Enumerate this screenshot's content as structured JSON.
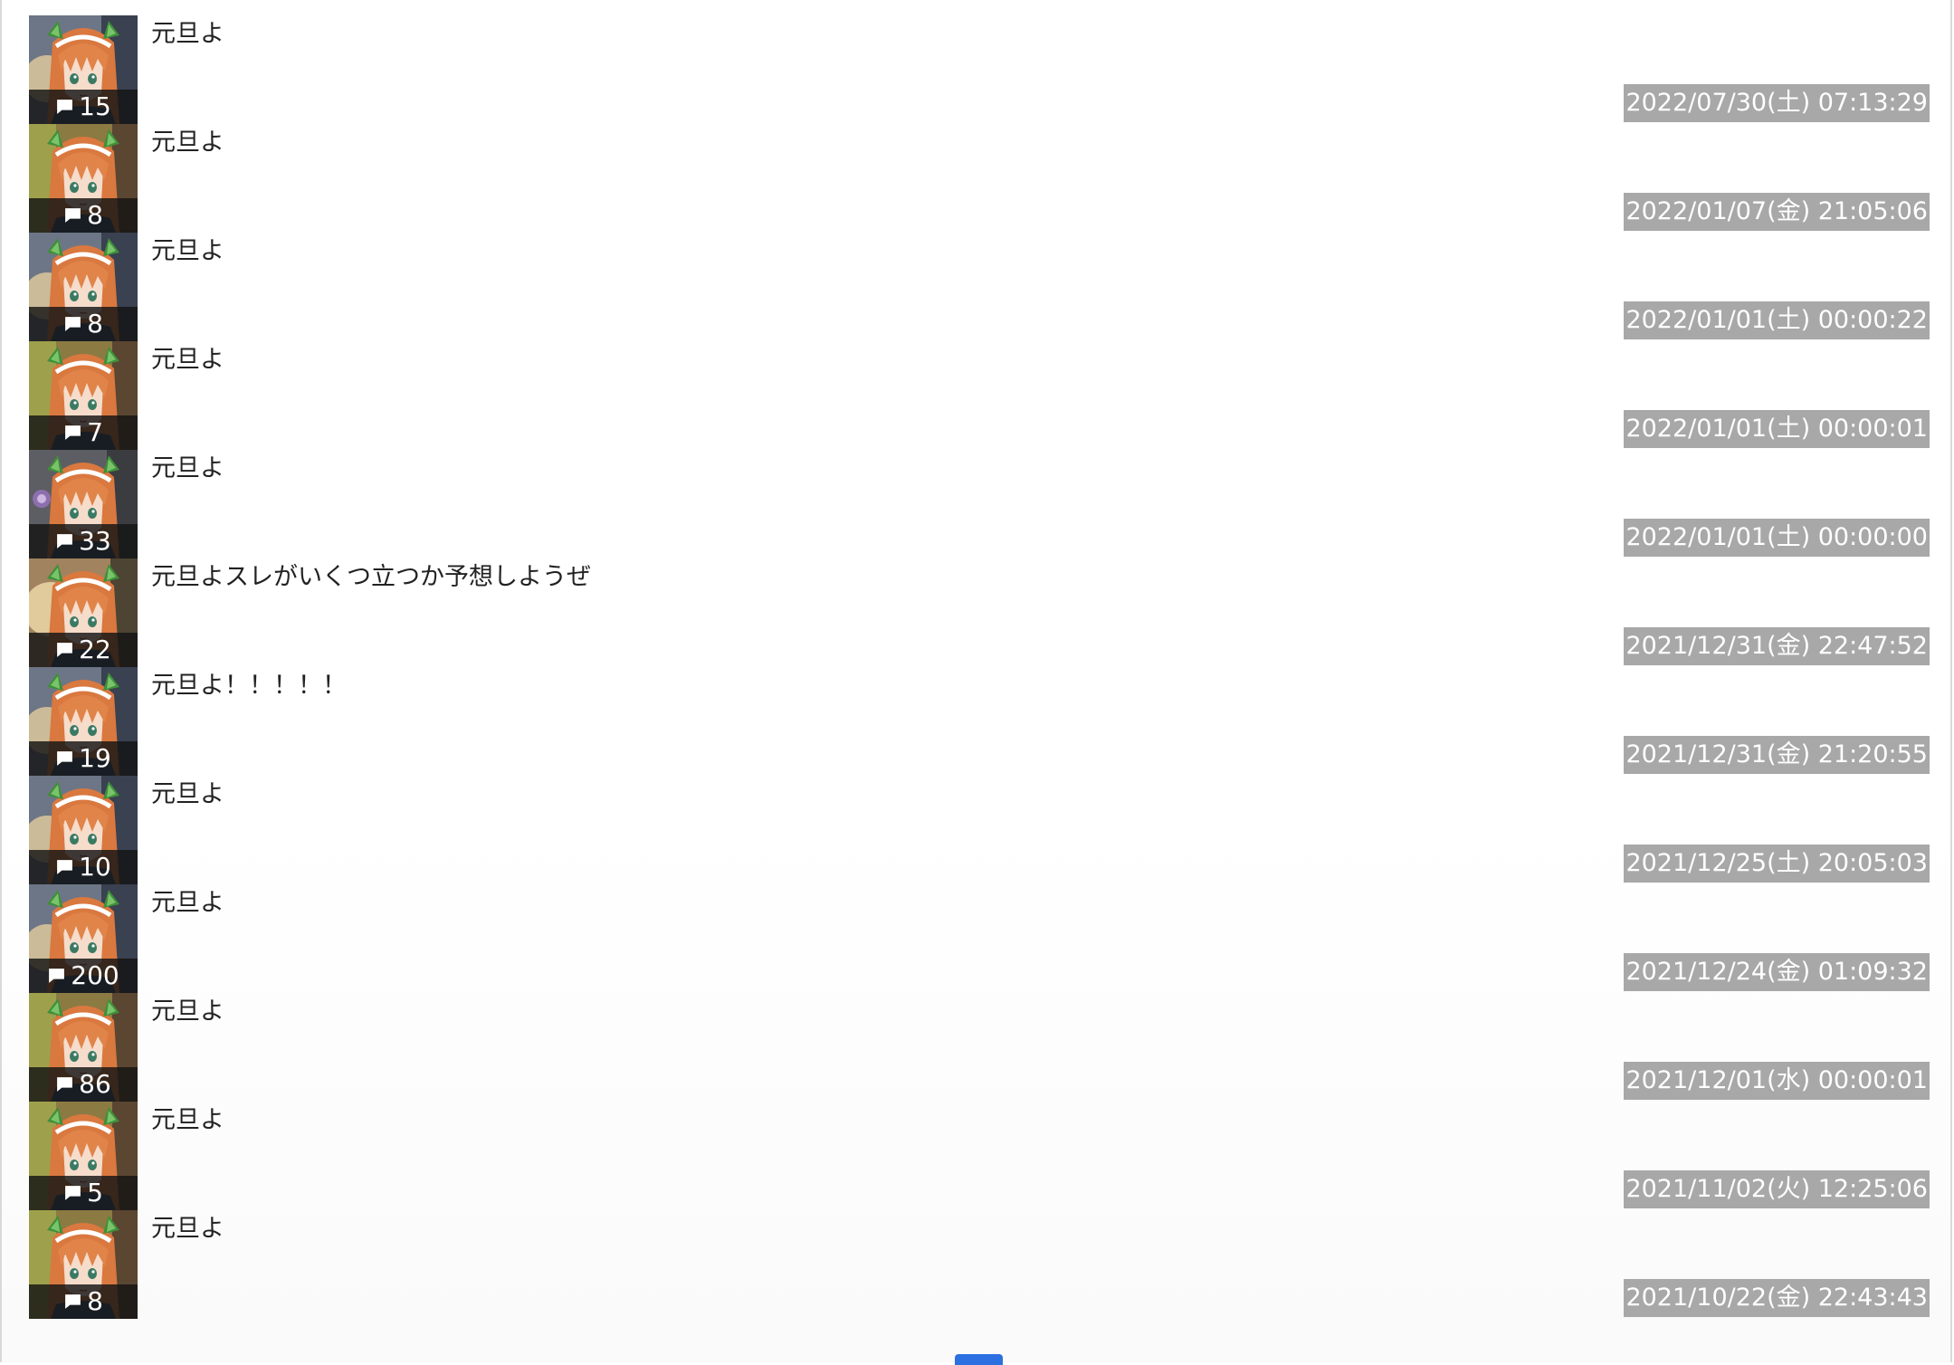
{
  "colors": {
    "date_badge_bg": "#a8a8a8",
    "count_badge_bg": "#141414",
    "pager_accent": "#2c6fe0",
    "title_text": "#222222"
  },
  "icons": {
    "count": "comment-icon"
  },
  "threads": [
    {
      "title": "元旦よ",
      "count": "15",
      "date": "2022/07/30(土) 07:13:29"
    },
    {
      "title": "元旦よ",
      "count": "8",
      "date": "2022/01/07(金) 21:05:06"
    },
    {
      "title": "元旦よ",
      "count": "8",
      "date": "2022/01/01(土) 00:00:22"
    },
    {
      "title": "元旦よ",
      "count": "7",
      "date": "2022/01/01(土) 00:00:01"
    },
    {
      "title": "元旦よ",
      "count": "33",
      "date": "2022/01/01(土) 00:00:00"
    },
    {
      "title": "元旦よスレがいくつ立つか予想しようぜ",
      "count": "22",
      "date": "2021/12/31(金) 22:47:52"
    },
    {
      "title": "元旦よ！！！！！",
      "count": "19",
      "date": "2021/12/31(金) 21:20:55"
    },
    {
      "title": "元旦よ",
      "count": "10",
      "date": "2021/12/25(土) 20:05:03"
    },
    {
      "title": "元旦よ",
      "count": "200",
      "date": "2021/12/24(金) 01:09:32"
    },
    {
      "title": "元旦よ",
      "count": "86",
      "date": "2021/12/01(水) 00:00:01"
    },
    {
      "title": "元旦よ",
      "count": "5",
      "date": "2021/11/02(火) 12:25:06"
    },
    {
      "title": "元旦よ",
      "count": "8",
      "date": "2021/10/22(金) 22:43:43"
    }
  ]
}
